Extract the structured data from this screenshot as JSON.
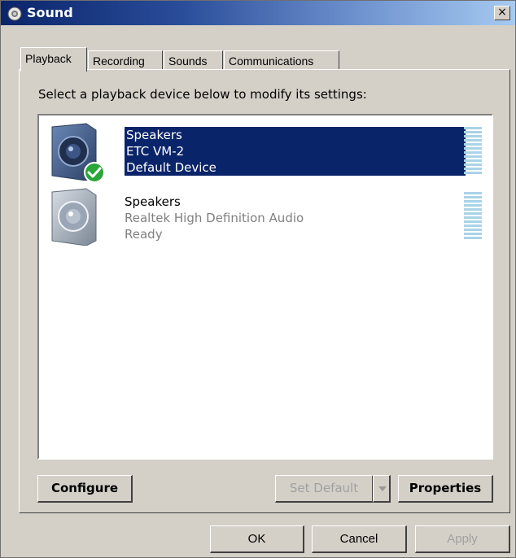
{
  "window": {
    "title": "Sound",
    "close_label": "×",
    "icon": "speaker-gear-icon"
  },
  "tabs": [
    {
      "label": "Playback",
      "active": true
    },
    {
      "label": "Recording",
      "active": false
    },
    {
      "label": "Sounds",
      "active": false
    },
    {
      "label": "Communications",
      "active": false
    }
  ],
  "instruction": "Select a playback device below to modify its settings:",
  "devices": [
    {
      "name": "Speakers",
      "detail": "ETC VM-2",
      "status": "Default Device",
      "selected": true,
      "icon": "speaker-default-icon",
      "badge": "check-icon"
    },
    {
      "name": "Speakers",
      "detail": "Realtek High Definition Audio",
      "status": "Ready",
      "selected": false,
      "icon": "speaker-icon"
    }
  ],
  "buttons": {
    "configure": "Configure",
    "set_default": "Set Default",
    "properties": "Properties",
    "ok": "OK",
    "cancel": "Cancel",
    "apply": "Apply"
  },
  "colors": {
    "selection": "#0a246a",
    "meter": "#a9d3e8",
    "check_badge": "#2aa53a"
  }
}
